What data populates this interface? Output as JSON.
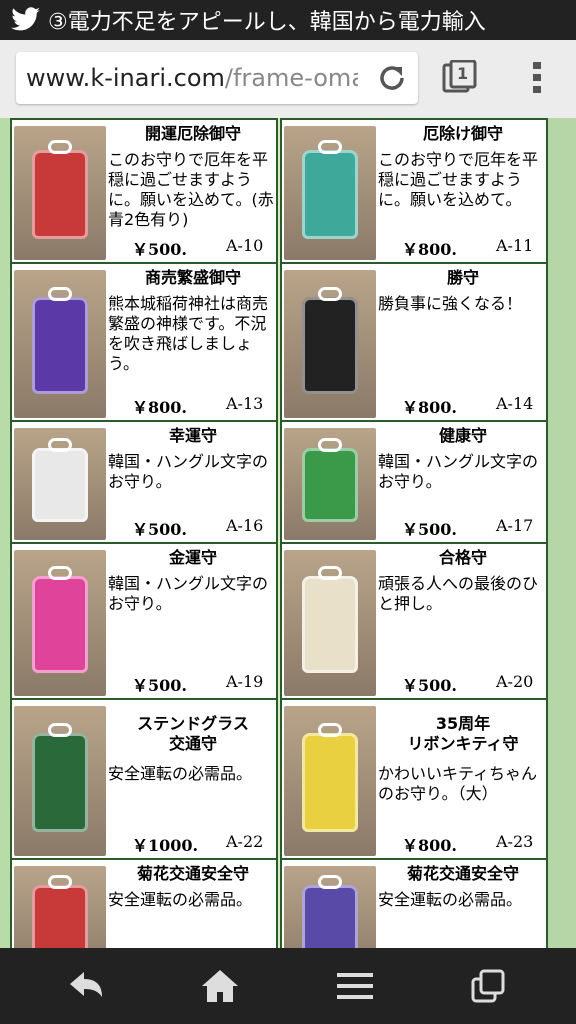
{
  "status_bar": {
    "title": "③電力不足をアピールし、韓国から電力輸入",
    "icon": "twitter-bird-icon"
  },
  "browser": {
    "url_domain": "www.k-inari.com",
    "url_path": "/frame-omamc",
    "tab_count": "1"
  },
  "items": [
    {
      "name": "開運厄除御守",
      "desc": "このお守りで厄年を平穏に過ごせますように。願いを込めて。(赤青2色有り)",
      "price": "￥500.",
      "code": "A-10",
      "color": "#c83a3a"
    },
    {
      "name": "厄除け御守",
      "desc": "このお守りで厄年を平穏に過ごせますように。願いを込めて。",
      "price": "￥800.",
      "code": "A-11",
      "color": "#3ea89a"
    },
    {
      "name": "商売繁盛御守",
      "desc": "熊本城稲荷神社は商売繁盛の神様です。不況を吹き飛ばしましょう。",
      "price": "￥800.",
      "code": "A-13",
      "color": "#5b3aa8"
    },
    {
      "name": "勝守",
      "desc": "勝負事に強くなる！",
      "price": "￥800.",
      "code": "A-14",
      "color": "#222222"
    },
    {
      "name": "幸運守",
      "desc": "韓国・ハングル文字のお守り。",
      "price": "￥500.",
      "code": "A-16",
      "color": "#e8e8e8"
    },
    {
      "name": "健康守",
      "desc": "韓国・ハングル文字のお守り。",
      "price": "￥500.",
      "code": "A-17",
      "color": "#3a9a4a"
    },
    {
      "name": "金運守",
      "desc": "韓国・ハングル文字のお守り。",
      "price": "￥500.",
      "code": "A-19",
      "color": "#e0439a"
    },
    {
      "name": "合格守",
      "desc": "頑張る人への最後のひと押し。",
      "price": "￥500.",
      "code": "A-20",
      "color": "#e8e0c8"
    },
    {
      "name": "ステンドグラス\n交通守",
      "desc": "安全運転の必需品。",
      "price": "￥1000.",
      "code": "A-22",
      "color": "#2a6a3a"
    },
    {
      "name": "35周年\nリボンキティ守",
      "desc": "かわいいキティちゃんのお守り。（大）",
      "price": "￥800.",
      "code": "A-23",
      "color": "#e8d040"
    },
    {
      "name": "菊花交通安全守",
      "desc": "安全運転の必需品。",
      "price": "",
      "code": "",
      "color": "#c83a3a"
    },
    {
      "name": "菊花交通安全守",
      "desc": "安全運転の必需品。",
      "price": "",
      "code": "",
      "color": "#5a4aa8"
    }
  ],
  "nav": {
    "back": "back-arrow-icon",
    "home": "home-icon",
    "menu": "menu-lines-icon",
    "recent": "recent-apps-icon"
  }
}
